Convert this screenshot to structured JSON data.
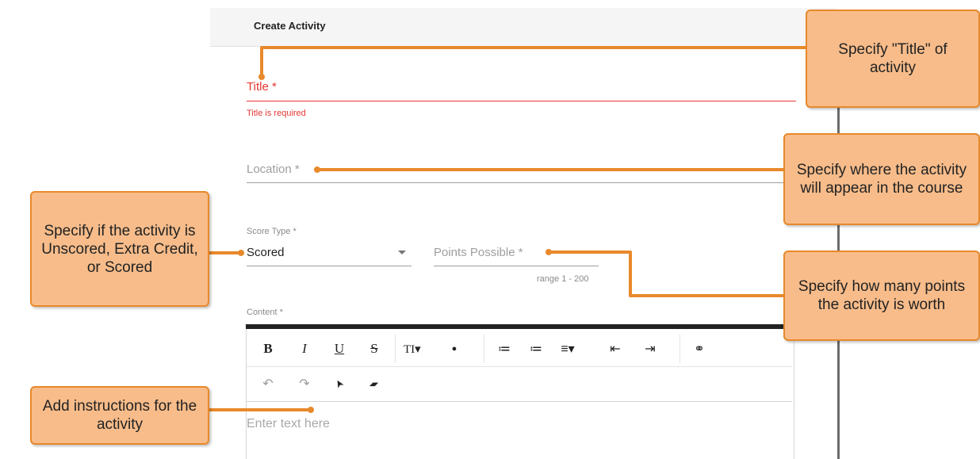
{
  "dialog": {
    "title": "Create Activity",
    "title_field": {
      "label": "Title *",
      "error": "Title is required"
    },
    "location_field": {
      "label": "Location *"
    },
    "score_type": {
      "label": "Score Type *",
      "value": "Scored"
    },
    "points_possible": {
      "label": "Points Possible *",
      "hint": "range 1 - 200"
    },
    "content": {
      "label": "Content *",
      "placeholder": "Enter text here",
      "toolbar": [
        {
          "name": "bold",
          "glyph": "B"
        },
        {
          "name": "italic",
          "glyph": "I"
        },
        {
          "name": "underline",
          "glyph": "U"
        },
        {
          "name": "strikethrough",
          "glyph": "S"
        },
        {
          "name": "font-size",
          "glyph": "TI▾"
        },
        {
          "name": "text-color",
          "glyph": "●"
        },
        {
          "name": "bullet-list",
          "glyph": "≔"
        },
        {
          "name": "numbered-list",
          "glyph": "≔"
        },
        {
          "name": "align",
          "glyph": "≡▾"
        },
        {
          "name": "outdent",
          "glyph": "⇤"
        },
        {
          "name": "indent",
          "glyph": "⇥"
        },
        {
          "name": "link",
          "glyph": "⚭"
        },
        {
          "name": "undo",
          "glyph": "↶"
        },
        {
          "name": "redo",
          "glyph": "↷"
        },
        {
          "name": "select",
          "glyph": "➤"
        },
        {
          "name": "eraser",
          "glyph": "▰"
        }
      ]
    }
  },
  "callouts": {
    "title": "Specify \"Title\" of activity",
    "location": "Specify where the activity will appear in the course",
    "score": "Specify if the activity is Unscored, Extra Credit, or Scored",
    "points": "Specify how many points the activity is worth",
    "content": "Add instructions for the activity"
  },
  "colors": {
    "callout_fill": "#f7bc8a",
    "callout_border": "#e8892b",
    "connector": "#e8892b",
    "error": "#e53935"
  }
}
